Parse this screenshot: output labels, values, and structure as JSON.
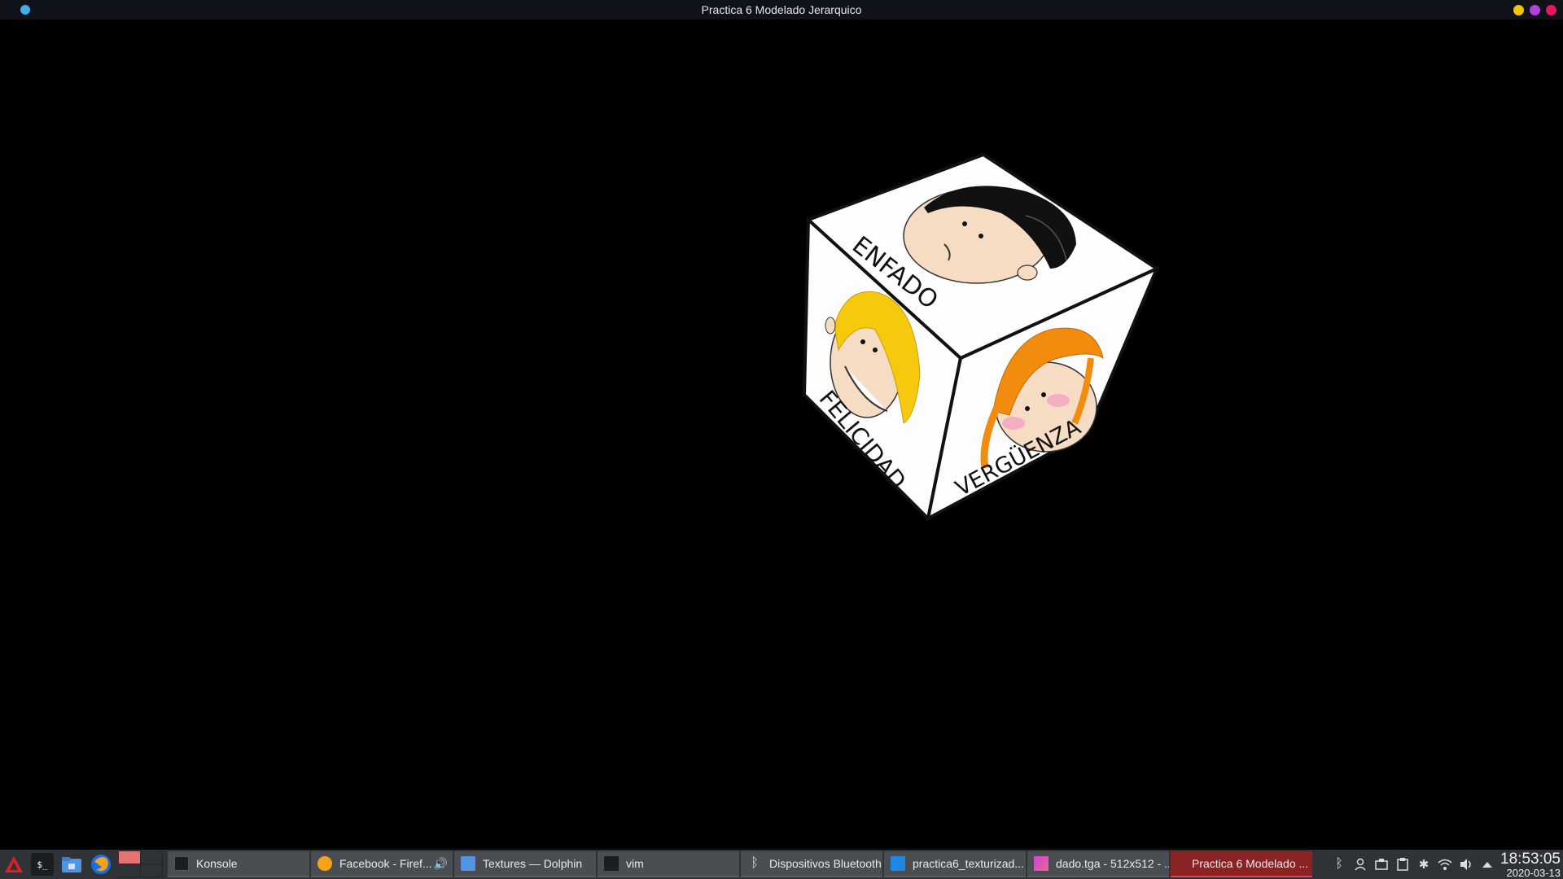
{
  "window": {
    "title": "Practica 6 Modelado Jerarquico",
    "accent": "#3daee9",
    "buttons": [
      {
        "name": "minimize",
        "color": "#f5c400"
      },
      {
        "name": "maximize",
        "color": "#b040e0"
      },
      {
        "name": "close",
        "color": "#e8175d"
      }
    ]
  },
  "scene": {
    "background": "#000000",
    "cube_faces": {
      "top": "ENFADO",
      "left": "FELICIDAD",
      "right": "VERGÜENZA"
    }
  },
  "taskbar": {
    "launchers": [
      {
        "name": "app-menu-icon",
        "symbol": "▲"
      },
      {
        "name": "terminal-icon",
        "symbol": "$_"
      },
      {
        "name": "file-manager-icon",
        "symbol": ""
      },
      {
        "name": "firefox-icon",
        "symbol": ""
      }
    ],
    "tasks": [
      {
        "label": "Konsole",
        "icon": "konsole-icon"
      },
      {
        "label": "Facebook - Firef...",
        "icon": "firefox-icon"
      },
      {
        "label": "Textures — Dolphin",
        "icon": "dolphin-icon"
      },
      {
        "label": "vim",
        "icon": "terminal-icon"
      },
      {
        "label": "Dispositivos Bluetooth",
        "icon": "bluetooth-icon"
      },
      {
        "label": "practica6_texturizad...",
        "icon": "vscode-icon"
      },
      {
        "label": "dado.tga - 512x512 - ...",
        "icon": "image-viewer-icon"
      },
      {
        "label": "Practica 6 Modelado ...",
        "icon": "opengl-window-icon"
      }
    ],
    "tray": [
      "bluetooth-icon",
      "user-icon",
      "device-icon",
      "clipboard-icon",
      "network-icon",
      "wifi-icon",
      "volume-icon",
      "expand-icon"
    ],
    "clock": {
      "time": "18:53:05",
      "date": "2020-03-13"
    }
  }
}
